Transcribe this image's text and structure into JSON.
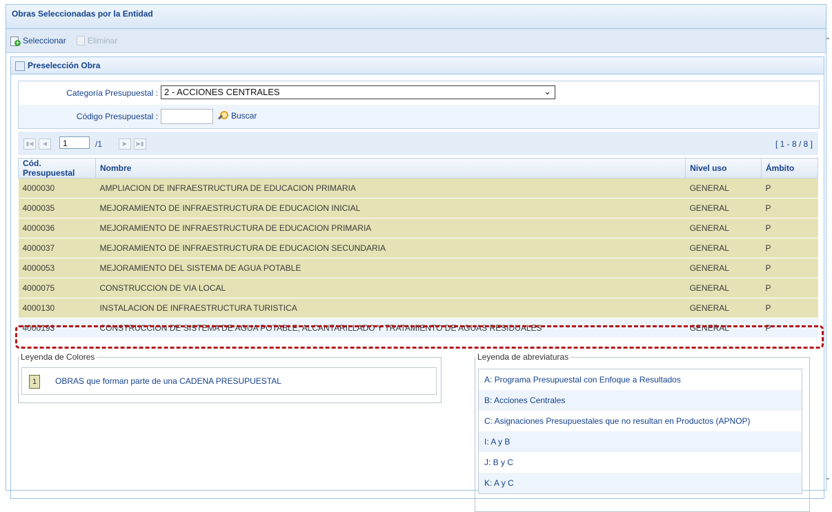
{
  "window": {
    "title": "Obras Seleccionadas por la Entidad"
  },
  "toolbar": {
    "select_label": "Seleccionar",
    "delete_label": "Eliminar"
  },
  "panel": {
    "title": "Preselección Obra"
  },
  "filter": {
    "category_label": "Categoría Presupuestal :",
    "category_value": "2 - ACCIONES CENTRALES",
    "code_label": "Código Presupuestal :",
    "code_value": "",
    "search_label": "Buscar"
  },
  "pager": {
    "page": "1",
    "total": "/1",
    "range": "[ 1 - 8 / 8 ]"
  },
  "table": {
    "columns": [
      "Cód. Presupuestal",
      "Nombre",
      "Nivel uso",
      "Ámbito"
    ],
    "rows": [
      {
        "code": "4000030",
        "name": "AMPLIACION DE INFRAESTRUCTURA DE EDUCACION PRIMARIA",
        "level": "GENERAL",
        "scope": "P"
      },
      {
        "code": "4000035",
        "name": "MEJORAMIENTO DE INFRAESTRUCTURA DE EDUCACION INICIAL",
        "level": "GENERAL",
        "scope": "P"
      },
      {
        "code": "4000036",
        "name": "MEJORAMIENTO DE INFRAESTRUCTURA DE EDUCACION PRIMARIA",
        "level": "GENERAL",
        "scope": "P"
      },
      {
        "code": "4000037",
        "name": "MEJORAMIENTO DE INFRAESTRUCTURA DE EDUCACION SECUNDARIA",
        "level": "GENERAL",
        "scope": "P"
      },
      {
        "code": "4000053",
        "name": "MEJORAMIENTO DEL SISTEMA DE AGUA POTABLE",
        "level": "GENERAL",
        "scope": "P"
      },
      {
        "code": "4000075",
        "name": "CONSTRUCCION DE VIA LOCAL",
        "level": "GENERAL",
        "scope": "P"
      },
      {
        "code": "4000130",
        "name": "INSTALACION DE INFRAESTRUCTURA TURISTICA",
        "level": "GENERAL",
        "scope": "P"
      },
      {
        "code": "4000193",
        "name": "CONSTRUCCION DE SISTEMA DE AGUA POTABLE, ALCANTARILLADO Y TRATAMIENTO DE AGUAS RESIDUALES",
        "level": "GENERAL",
        "scope": "P"
      }
    ]
  },
  "color_legend": {
    "title": "Leyenda de Colores",
    "swatch_text": "1",
    "swatch_color": "#e5e3b5",
    "text": "OBRAS que forman parte de una CADENA PRESUPUESTAL"
  },
  "abbr_legend": {
    "title": "Leyenda de abreviaturas",
    "items": [
      "A: Programa Presupuestal con Enfoque a Resultados",
      "B: Acciones Centrales",
      "C: Asignaciones Presupuestales que no resultan en Productos (APNOP)",
      "I: A y B",
      "J: B y C",
      "K: A y C"
    ]
  },
  "colors": {
    "accent": "#15428b",
    "highlight_border": "#b3161c",
    "row_normal": "#eef4fb"
  }
}
